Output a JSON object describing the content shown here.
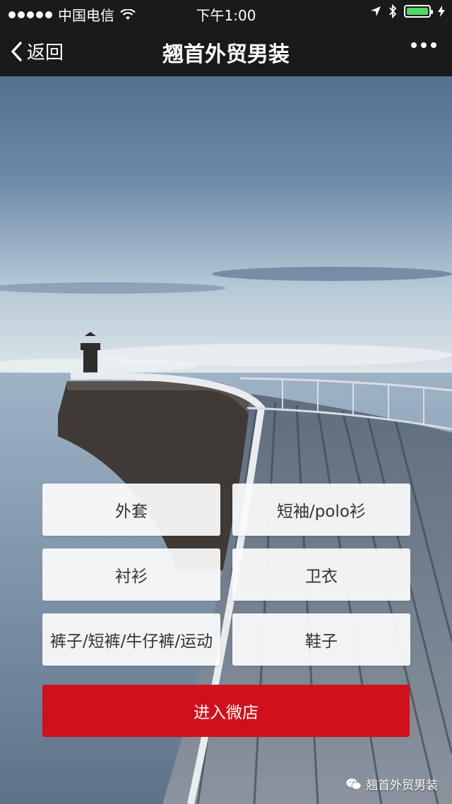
{
  "status": {
    "carrier": "中国电信",
    "time": "下午1:00",
    "battery_level": 1.0,
    "battery_color": "#4cd964"
  },
  "nav": {
    "back_label": "返回",
    "title": "翘首外贸男装",
    "more_icon": "ellipsis-icon"
  },
  "categories": [
    {
      "label": "外套"
    },
    {
      "label": "短袖/polo衫"
    },
    {
      "label": "衬衫"
    },
    {
      "label": "卫衣"
    },
    {
      "label": "裤子/短裤/牛仔裤/运动"
    },
    {
      "label": "鞋子"
    }
  ],
  "enter_button": {
    "label": "进入微店",
    "color": "#d0111b"
  },
  "watermark": {
    "text": "翘首外贸男装",
    "icon": "wechat-icon"
  }
}
